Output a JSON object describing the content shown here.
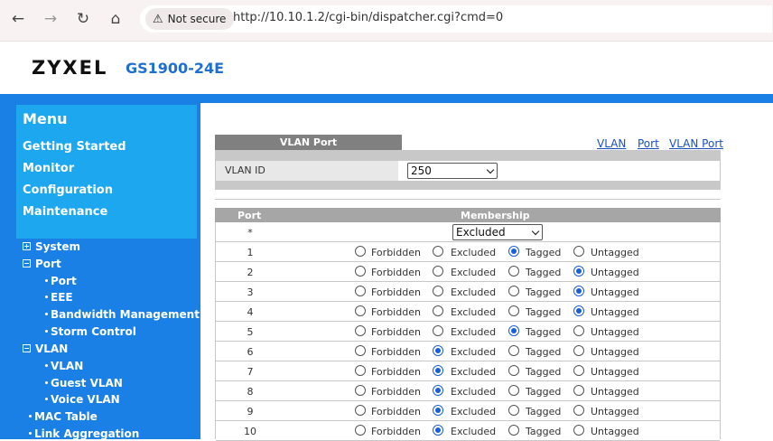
{
  "browser": {
    "security_label": "Not secure",
    "url": "http://10.10.1.2/cgi-bin/dispatcher.cgi?cmd=0"
  },
  "header": {
    "logo": "ZYXEL",
    "model": "GS1900-24E"
  },
  "menu": {
    "title": "Menu",
    "links": [
      "Getting Started",
      "Monitor",
      "Configuration",
      "Maintenance"
    ]
  },
  "tree": {
    "system": "System",
    "port": "Port",
    "port_children": [
      "Port",
      "EEE",
      "Bandwidth Management",
      "Storm Control"
    ],
    "vlan": "VLAN",
    "vlan_children": [
      "VLAN",
      "Guest VLAN",
      "Voice VLAN"
    ],
    "mac_table": "MAC Table",
    "link_aggregation": "Link Aggregation"
  },
  "content": {
    "panel_title": "VLAN Port",
    "links": [
      "VLAN",
      "Port",
      "VLAN Port"
    ],
    "vlan_id_label": "VLAN ID",
    "vlan_id_value": "250",
    "col_port": "Port",
    "col_membership": "Membership",
    "all_port_symbol": "*",
    "all_membership_value": "Excluded",
    "options": [
      "Forbidden",
      "Excluded",
      "Tagged",
      "Untagged"
    ],
    "rows": [
      {
        "port": "1",
        "selected": "Tagged"
      },
      {
        "port": "2",
        "selected": "Untagged"
      },
      {
        "port": "3",
        "selected": "Untagged"
      },
      {
        "port": "4",
        "selected": "Untagged"
      },
      {
        "port": "5",
        "selected": "Tagged"
      },
      {
        "port": "6",
        "selected": "Excluded"
      },
      {
        "port": "7",
        "selected": "Excluded"
      },
      {
        "port": "8",
        "selected": "Excluded"
      },
      {
        "port": "9",
        "selected": "Excluded"
      },
      {
        "port": "10",
        "selected": "Excluded"
      }
    ]
  },
  "colors": {
    "brand_blue": "#1a80e6",
    "menu_blue": "#1ca7ef",
    "radio_selected": "#1a5fd6"
  }
}
